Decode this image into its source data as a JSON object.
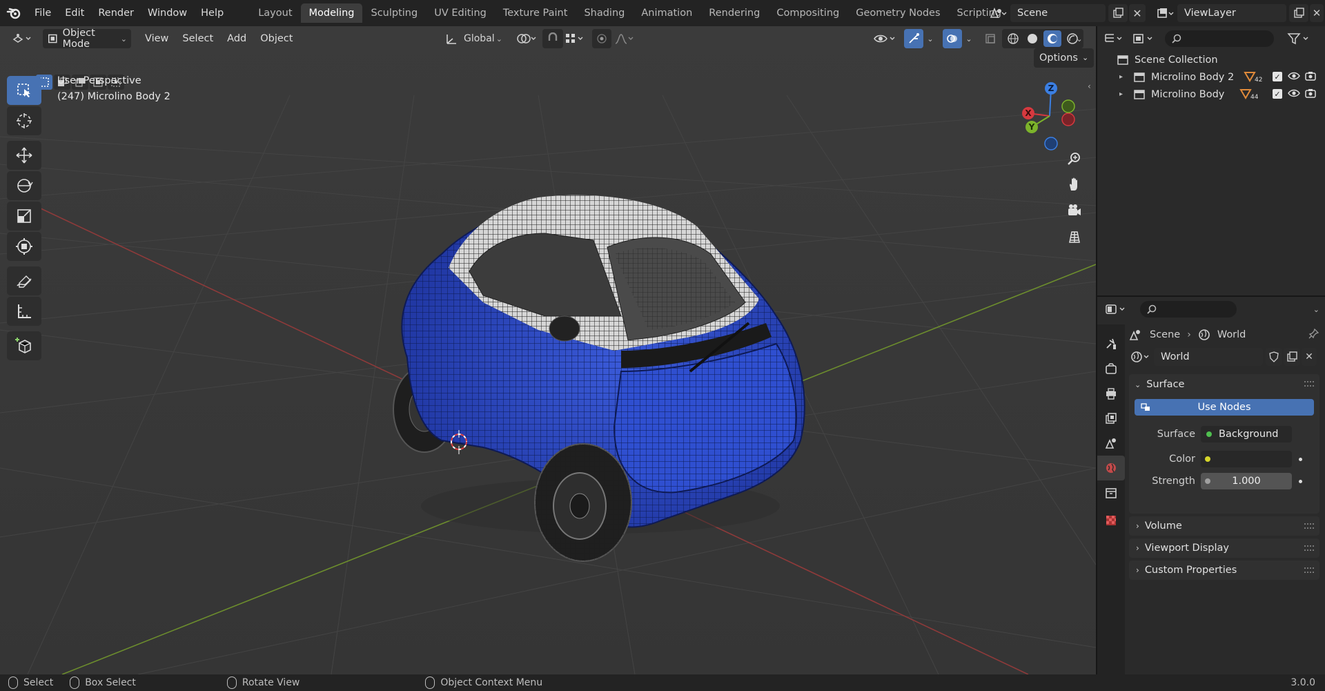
{
  "topbar": {
    "menus": [
      "File",
      "Edit",
      "Render",
      "Window",
      "Help"
    ],
    "workspaces": [
      "Layout",
      "Modeling",
      "Sculpting",
      "UV Editing",
      "Texture Paint",
      "Shading",
      "Animation",
      "Rendering",
      "Compositing",
      "Geometry Nodes",
      "Scripting"
    ],
    "active_workspace": "Modeling",
    "scene_name": "Scene",
    "view_layer": "ViewLayer"
  },
  "viewport": {
    "mode": "Object Mode",
    "menus": [
      "View",
      "Select",
      "Add",
      "Object"
    ],
    "transform_orientation": "Global",
    "options_label": "Options",
    "info_line1": "User Perspective",
    "info_line2": "(247) Microlino Body 2",
    "gizmo_axes": {
      "x": "X",
      "y": "Y",
      "z": "Z"
    },
    "colors": {
      "x_axis": "#d6393f",
      "y_axis": "#7cb32b",
      "z_axis": "#3b7fe3",
      "car_body": "#2a47c4"
    }
  },
  "tools": [
    "select-box",
    "cursor",
    "move",
    "rotate",
    "scale",
    "transform",
    "annotate",
    "measure",
    "add-cube"
  ],
  "outliner": {
    "root": "Scene Collection",
    "items": [
      {
        "name": "Microlino Body 2",
        "badge": "42"
      },
      {
        "name": "Microlino Body",
        "badge": "44"
      }
    ]
  },
  "properties": {
    "breadcrumb_scene": "Scene",
    "breadcrumb_world": "World",
    "world_name": "World",
    "surface_panel": "Surface",
    "use_nodes_label": "Use Nodes",
    "surface_label": "Surface",
    "surface_value": "Background",
    "color_label": "Color",
    "strength_label": "Strength",
    "strength_value": "1.000",
    "collapsed_panels": [
      "Volume",
      "Viewport Display",
      "Custom Properties"
    ]
  },
  "statusbar": {
    "select": "Select",
    "box_select": "Box Select",
    "rotate_view": "Rotate View",
    "context_menu": "Object Context Menu",
    "version": "3.0.0"
  }
}
